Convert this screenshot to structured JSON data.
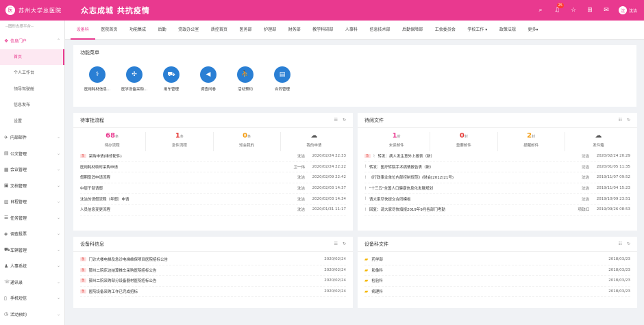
{
  "header": {
    "logo_glyph": "医",
    "logo_text": "苏州大学总医院",
    "slogan": "众志成城 共抗疫情",
    "notif_count": "25",
    "user_name": "沈洁",
    "avatar_glyph": "沈",
    "icons": [
      "search-icon",
      "bell-icon",
      "star-icon",
      "apps-icon",
      "wechat-icon"
    ]
  },
  "sidebar": {
    "hint": "--图形支撑平台--",
    "portal": {
      "label": "信息门户",
      "arrow": "⌃"
    },
    "sub_items": [
      "首页",
      "个人工作台",
      "领导驾驶舱",
      "信息发布",
      "设置"
    ],
    "items": [
      {
        "label": "内部邮件",
        "icon": "✈"
      },
      {
        "label": "公文管理",
        "icon": "▤"
      },
      {
        "label": "会议管理",
        "icon": "▦"
      },
      {
        "label": "文档管理",
        "icon": "▣"
      },
      {
        "label": "日程管理",
        "icon": "▥"
      },
      {
        "label": "任务管理",
        "icon": "☰"
      },
      {
        "label": "调查投票",
        "icon": "◈"
      },
      {
        "label": "车辆管理",
        "icon": "⛟"
      },
      {
        "label": "人事系统",
        "icon": "♟"
      },
      {
        "label": "通讯录",
        "icon": "☏"
      },
      {
        "label": "手机短信",
        "icon": "▯"
      },
      {
        "label": "活动预约",
        "icon": "◷"
      }
    ],
    "arrow": "⌄"
  },
  "tabs": [
    "设备科",
    "医院首页",
    "功能集成",
    "后勤",
    "党政办公室",
    "质控首页",
    "医务部",
    "护理部",
    "财务部",
    "教学科研部",
    "人事科",
    "信息技术部",
    "后勤保障部",
    "工会委员会",
    "学校工作 ▾",
    "政策法规",
    "更多▾"
  ],
  "func_menu": {
    "title": "功能菜单",
    "items": [
      {
        "label": "医用耗材信息...",
        "icon": "⚕"
      },
      {
        "label": "医学设备采购...",
        "icon": "✣"
      },
      {
        "label": "用车管理",
        "icon": "⛟"
      },
      {
        "label": "调查问卷",
        "icon": "◀"
      },
      {
        "label": "活动预约",
        "icon": "⛹"
      },
      {
        "label": "合同管理",
        "icon": "▤"
      }
    ]
  },
  "pending": {
    "title": "待审批流程",
    "ctrl_list": "☷",
    "ctrl_refresh": "↻",
    "stats": [
      {
        "num": "68",
        "unit": "条",
        "label": "待办流程",
        "color": "pink"
      },
      {
        "num": "1",
        "unit": "条",
        "label": "急件流程",
        "color": "red"
      },
      {
        "num": "0",
        "unit": "条",
        "label": "知会我的",
        "color": "orange"
      },
      {
        "num": "☁",
        "unit": "",
        "label": "我的申请",
        "color": "gray"
      }
    ],
    "rows": [
      {
        "tag": "急",
        "title": "采购申请(维修配件)",
        "author": "沈洁",
        "date": "2020/02/24 22:33"
      },
      {
        "tag": "",
        "title": "医用耗材临时采购申请",
        "author": "卫一伟",
        "date": "2020/02/24 22:22"
      },
      {
        "tag": "",
        "title": "假期取消申请流程",
        "author": "沈洁",
        "date": "2020/02/09 22:42"
      },
      {
        "tag": "",
        "title": "中层干部请假",
        "author": "沈洁",
        "date": "2020/02/03 14:37"
      },
      {
        "tag": "",
        "title": "沈洁的请假流程（年假）申请",
        "author": "沈洁",
        "date": "2020/02/03 14:34"
      },
      {
        "tag": "",
        "title": "人员信息变更流程",
        "author": "沈洁",
        "date": "2020/01/31 11:17"
      }
    ]
  },
  "docs": {
    "title": "待阅文件",
    "stats": [
      {
        "num": "1",
        "unit": "封",
        "label": "未读邮件",
        "color": "pink"
      },
      {
        "num": "0",
        "unit": "封",
        "label": "重要邮件",
        "color": "red"
      },
      {
        "num": "2",
        "unit": "封",
        "label": "提醒邮件",
        "color": "orange"
      },
      {
        "num": "☁",
        "unit": "",
        "label": "发件箱",
        "color": "gray"
      }
    ],
    "rows": [
      {
        "tag": "急",
        "title": "转发：病人发生意外上报表（新）",
        "author": "沈洁",
        "date": "2020/02/24 20:29"
      },
      {
        "tag": "",
        "title": "转发：医疗转院手术病情报告表（新）",
        "author": "沈洁",
        "date": "2020/01/05 11:35"
      },
      {
        "tag": "",
        "title": "《行政事业单位内部控制规范》(财会[2012]21号)",
        "author": "沈洁",
        "date": "2019/11/07 09:52"
      },
      {
        "tag": "",
        "title": "\"十三五\"全国人口健康信息化发展规划",
        "author": "沈洁",
        "date": "2019/11/04 15:23"
      },
      {
        "tag": "",
        "title": "请大家尽快提交合同模板",
        "author": "沈洁",
        "date": "2019/10/09 23:51"
      },
      {
        "tag": "",
        "title": "回复：请大家尽快填报2019年9月各部门考勤",
        "author": "项政红",
        "date": "2019/09/26 08:53"
      }
    ]
  },
  "equip_info": {
    "title": "设备科信息",
    "rows": [
      {
        "tag": "急",
        "title": "门诊大楼电梯及急诊电梯维保项目医院招标公告",
        "date": "2020/02/24"
      },
      {
        "tag": "急",
        "title": "鄞州二院床边结算推车采购医院招标公告",
        "date": "2020/02/24"
      },
      {
        "tag": "急",
        "title": "鄞州二院采购部分设备器材医院招标公告",
        "date": "2020/02/24"
      },
      {
        "tag": "急",
        "title": "医院设备采购工作已完成招标",
        "date": "2020/02/24"
      }
    ]
  },
  "equip_files": {
    "title": "设备科文件",
    "rows": [
      {
        "title": "药学部",
        "date": "2018/03/23"
      },
      {
        "title": "影像科",
        "date": "2018/03/23"
      },
      {
        "title": "检验科",
        "date": "2018/03/23"
      },
      {
        "title": "病理科",
        "date": "2018/03/23"
      }
    ]
  },
  "colors": {
    "brand": "#e9398f",
    "icon_blue": "#2a7fd4",
    "urgent": "#e53935",
    "folder": "#f5b800"
  }
}
